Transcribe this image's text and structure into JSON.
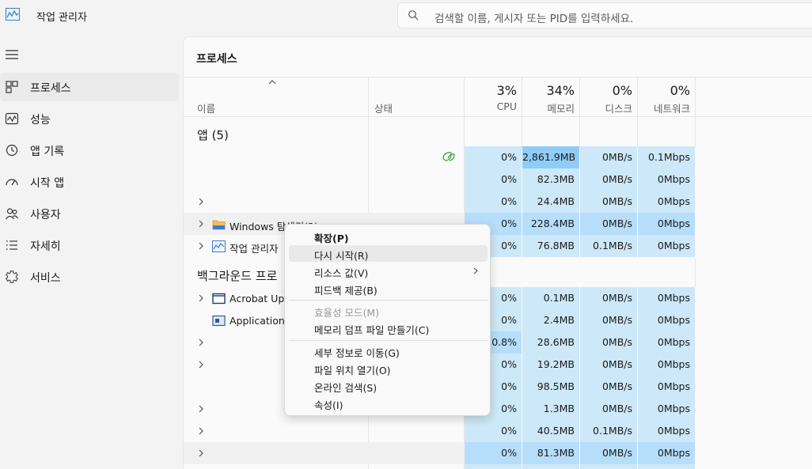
{
  "app": {
    "title": "작업 관리자",
    "search_placeholder": "검색할 이름, 게시자 또는 PID를 입력하세요."
  },
  "nav": {
    "items": [
      {
        "label": "프로세스",
        "icon": "processes-icon",
        "active": true
      },
      {
        "label": "성능",
        "icon": "performance-icon"
      },
      {
        "label": "앱 기록",
        "icon": "app-history-icon"
      },
      {
        "label": "시작 앱",
        "icon": "startup-apps-icon"
      },
      {
        "label": "사용자",
        "icon": "users-icon"
      },
      {
        "label": "자세히",
        "icon": "details-icon"
      },
      {
        "label": "서비스",
        "icon": "services-icon"
      }
    ]
  },
  "main": {
    "title": "프로세스",
    "columns": {
      "name": "이름",
      "status": "상태",
      "cpu": {
        "pct": "3%",
        "label": "CPU"
      },
      "memory": {
        "pct": "34%",
        "label": "메모리"
      },
      "disk": {
        "pct": "0%",
        "label": "디스크"
      },
      "network": {
        "pct": "0%",
        "label": "네트워크"
      }
    },
    "groups": {
      "apps": "앱 (5)",
      "background": "백그라운드 프로"
    },
    "rows": [
      {
        "name": "",
        "cpu": "0%",
        "mem": "2,861.9MB",
        "disk": "0MB/s",
        "net": "0.1Mbps"
      },
      {
        "name": "",
        "cpu": "0%",
        "mem": "82.3MB",
        "disk": "0MB/s",
        "net": "0Mbps"
      },
      {
        "name": "",
        "cpu": "0%",
        "mem": "24.4MB",
        "disk": "0MB/s",
        "net": "0Mbps"
      },
      {
        "name": "Windows 탐색기(2)",
        "cpu": "0%",
        "mem": "228.4MB",
        "disk": "0MB/s",
        "net": "0Mbps"
      },
      {
        "name": "작업 관리자",
        "cpu": "0%",
        "mem": "76.8MB",
        "disk": "0.1MB/s",
        "net": "0Mbps"
      },
      {
        "name": "Acrobat Upd",
        "cpu": "0%",
        "mem": "0.1MB",
        "disk": "0MB/s",
        "net": "0Mbps"
      },
      {
        "name": "Application F",
        "cpu": "0%",
        "mem": "2.4MB",
        "disk": "0MB/s",
        "net": "0Mbps"
      },
      {
        "name": "",
        "cpu": "0.8%",
        "mem": "28.6MB",
        "disk": "0MB/s",
        "net": "0Mbps"
      },
      {
        "name": "",
        "cpu": "0%",
        "mem": "19.2MB",
        "disk": "0MB/s",
        "net": "0Mbps"
      },
      {
        "name": "",
        "cpu": "0%",
        "mem": "98.5MB",
        "disk": "0MB/s",
        "net": "0Mbps"
      },
      {
        "name": "",
        "cpu": "0%",
        "mem": "1.3MB",
        "disk": "0MB/s",
        "net": "0Mbps"
      },
      {
        "name": "",
        "cpu": "0%",
        "mem": "40.5MB",
        "disk": "0.1MB/s",
        "net": "0Mbps"
      },
      {
        "name": "",
        "cpu": "0%",
        "mem": "81.3MB",
        "disk": "0MB/s",
        "net": "0Mbps"
      }
    ]
  },
  "context_menu": {
    "items": [
      {
        "label": "확장(P)",
        "bold": true
      },
      {
        "label": "다시 시작(R)",
        "highlight": true
      },
      {
        "label": "리소스 값(V)",
        "submenu": true
      },
      {
        "label": "피드백 제공(B)"
      },
      {
        "label": "효율성 모드(M)",
        "disabled": true
      },
      {
        "label": "메모리 덤프 파일 만들기(C)"
      },
      {
        "label": "세부 정보로 이동(G)"
      },
      {
        "label": "파일 위치 열기(O)"
      },
      {
        "label": "온라인 검색(S)"
      },
      {
        "label": "속성(I)"
      }
    ]
  },
  "colors": {
    "heat_light": "#cde8f8",
    "heat_dark": "#b6defa",
    "accent_mem": "#8fcdf6"
  }
}
